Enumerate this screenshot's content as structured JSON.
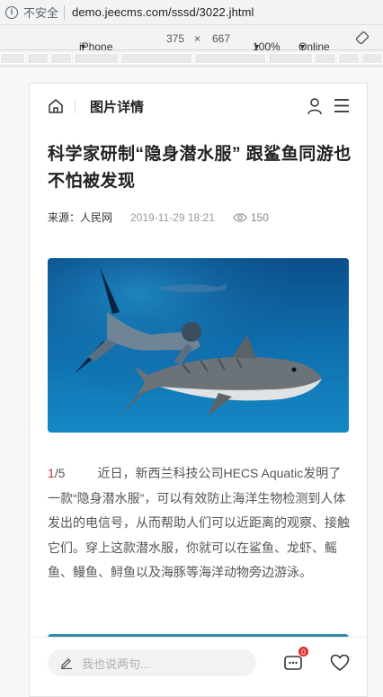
{
  "browser": {
    "insecure_label": "不安全",
    "url": "demo.jeecms.com/sssd/3022.jhtml"
  },
  "device_toolbar": {
    "device": "iPhone 6/...",
    "width": "375",
    "times": "×",
    "height": "667",
    "zoom": "100%",
    "network": "Online"
  },
  "header": {
    "title": "图片详情"
  },
  "article": {
    "title": "科学家研制“隐身潜水服” 跟鲨鱼同游也不怕被发现",
    "source": "来源：人民网",
    "time": "2019-11-29 18:21",
    "views": "150",
    "page_current": "1",
    "page_total": "/5",
    "body": "近日，新西兰科技公司HECS Aquatic发明了一款“隐身潜水服”，可以有效防止海洋生物检测到人体发出的电信号，从而帮助人们可以近距离的观察、接触它们。穿上这款潜水服，你就可以在鲨鱼、龙虾、鳐鱼、鳗鱼、鲟鱼以及海豚等海洋动物旁边游泳。"
  },
  "footer": {
    "comment_placeholder": "我也说两句...",
    "comment_count": "0"
  },
  "colors": {
    "accent": "#c5283d",
    "badge": "#e02b2b"
  }
}
